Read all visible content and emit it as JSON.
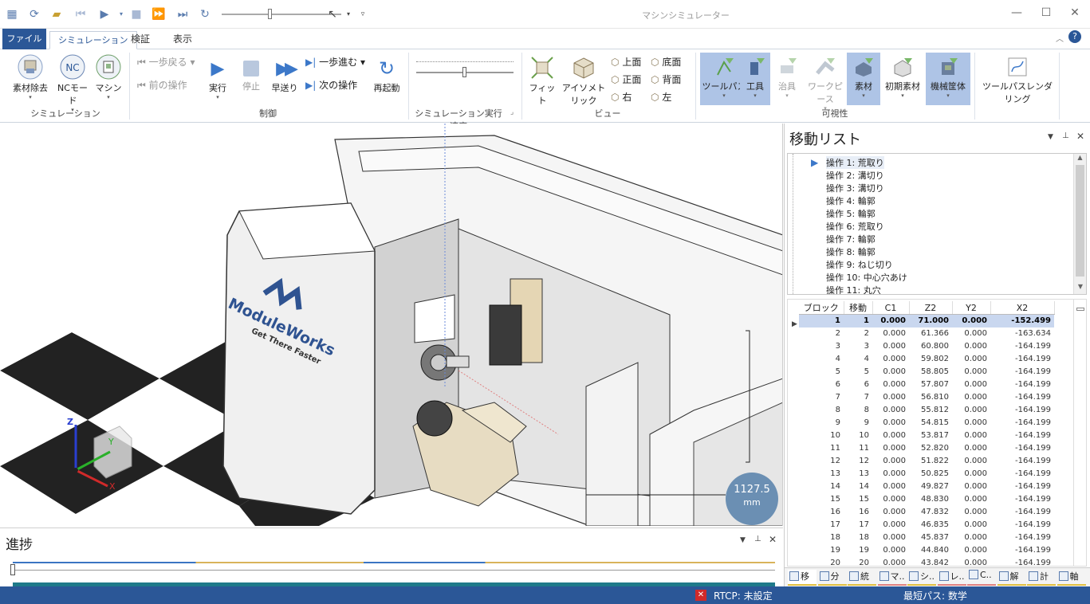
{
  "window": {
    "title": "マシンシミュレーター"
  },
  "tabs": [
    {
      "label": "ファイル"
    },
    {
      "label": "シミュレーション"
    },
    {
      "label": "検証"
    },
    {
      "label": "表示"
    }
  ],
  "ribbon": {
    "simulation_group": {
      "label": "シミュレーション",
      "buttons": [
        "素材除去",
        "NCモード",
        "マシン"
      ],
      "nc_icon_text": "NC"
    },
    "control_group": {
      "label": "制御",
      "step_back": "一歩戻る",
      "prev_op": "前の操作",
      "run": "実行",
      "stop": "停止",
      "fast_forward": "早送り",
      "step_forward": "一歩進む",
      "next_op": "次の操作",
      "restart": "再起動"
    },
    "speed_group": {
      "label": "シミュレーション実行速度"
    },
    "view_group": {
      "label": "ビュー",
      "fit": "フィット",
      "isometric": "アイソメトリック",
      "top": "上面",
      "bottom": "底面",
      "front": "正面",
      "back": "背面",
      "right": "右",
      "left": "左"
    },
    "visibility_group": {
      "label": "可視性",
      "items": [
        "ツールパス",
        "工具",
        "治具",
        "ワークピース",
        "素材",
        "初期素材",
        "機械筐体"
      ]
    },
    "toolpath_rendering": "ツールパスレンダリング"
  },
  "viewport": {
    "logo_text": "ModuleWorks",
    "logo_slogan": "Get There Faster",
    "dimension": {
      "value": "1127.5",
      "unit": "mm"
    },
    "axes": {
      "x": "X",
      "y": "Y",
      "z": "Z"
    }
  },
  "progress_panel": {
    "title": "進捗"
  },
  "move_list": {
    "title": "移動リスト",
    "operations": [
      "操作 1: 荒取り",
      "操作 2: 溝切り",
      "操作 3: 溝切り",
      "操作 4: 輪郭",
      "操作 5: 輪郭",
      "操作 6: 荒取り",
      "操作 7: 輪郭",
      "操作 8: 輪郭",
      "操作 9: ねじ切り",
      "操作 10: 中心穴あけ",
      "操作 11: 丸穴"
    ],
    "columns": [
      "ブロック",
      "移動",
      "C1",
      "Z2",
      "Y2",
      "X2"
    ],
    "rows": [
      [
        "1",
        "1",
        "0.000",
        "71.000",
        "0.000",
        "-152.499"
      ],
      [
        "2",
        "2",
        "0.000",
        "61.366",
        "0.000",
        "-163.634"
      ],
      [
        "3",
        "3",
        "0.000",
        "60.800",
        "0.000",
        "-164.199"
      ],
      [
        "4",
        "4",
        "0.000",
        "59.802",
        "0.000",
        "-164.199"
      ],
      [
        "5",
        "5",
        "0.000",
        "58.805",
        "0.000",
        "-164.199"
      ],
      [
        "6",
        "6",
        "0.000",
        "57.807",
        "0.000",
        "-164.199"
      ],
      [
        "7",
        "7",
        "0.000",
        "56.810",
        "0.000",
        "-164.199"
      ],
      [
        "8",
        "8",
        "0.000",
        "55.812",
        "0.000",
        "-164.199"
      ],
      [
        "9",
        "9",
        "0.000",
        "54.815",
        "0.000",
        "-164.199"
      ],
      [
        "10",
        "10",
        "0.000",
        "53.817",
        "0.000",
        "-164.199"
      ],
      [
        "11",
        "11",
        "0.000",
        "52.820",
        "0.000",
        "-164.199"
      ],
      [
        "12",
        "12",
        "0.000",
        "51.822",
        "0.000",
        "-164.199"
      ],
      [
        "13",
        "13",
        "0.000",
        "50.825",
        "0.000",
        "-164.199"
      ],
      [
        "14",
        "14",
        "0.000",
        "49.827",
        "0.000",
        "-164.199"
      ],
      [
        "15",
        "15",
        "0.000",
        "48.830",
        "0.000",
        "-164.199"
      ],
      [
        "16",
        "16",
        "0.000",
        "47.832",
        "0.000",
        "-164.199"
      ],
      [
        "17",
        "17",
        "0.000",
        "46.835",
        "0.000",
        "-164.199"
      ],
      [
        "18",
        "18",
        "0.000",
        "45.837",
        "0.000",
        "-164.199"
      ],
      [
        "19",
        "19",
        "0.000",
        "44.840",
        "0.000",
        "-164.199"
      ],
      [
        "20",
        "20",
        "0.000",
        "43.842",
        "0.000",
        "-164.199"
      ]
    ],
    "bottom_tabs": [
      "移",
      "分",
      "統",
      "マ..",
      "シ..",
      "レ..",
      "C..",
      "解",
      "計",
      "軸"
    ]
  },
  "status_bar": {
    "rtcp_label": "RTCP: 未設定",
    "path_label": "最短パス: 数学"
  }
}
